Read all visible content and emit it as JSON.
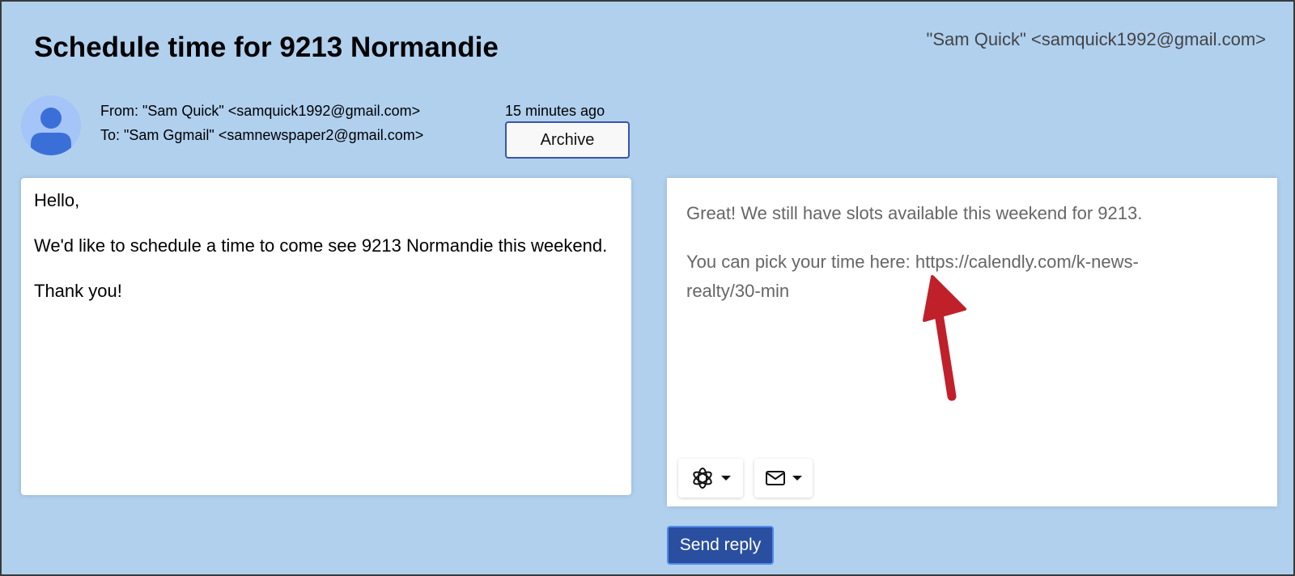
{
  "email": {
    "subject": "Schedule time for 9213 Normandie",
    "account": "\"Sam Quick\" <samquick1992@gmail.com>",
    "from_line": "From: \"Sam Quick\" <samquick1992@gmail.com>",
    "to_line": "To: \"Sam Ggmail\" <samnewspaper2@gmail.com>",
    "time": "15 minutes ago",
    "archive_label": "Archive",
    "body": {
      "line1": "Hello,",
      "line2": "We'd like to schedule a time to come see 9213 Normandie this weekend.",
      "line3": "Thank you!"
    }
  },
  "reply": {
    "line1": "Great! We still have slots available this weekend for 9213.",
    "line2": "You can pick your time here: https://calendly.com/k-news-realty/30-min",
    "ai_icon": "openai-icon",
    "mail_icon": "envelope-icon",
    "send_label": "Send reply"
  },
  "colors": {
    "background": "#b0d0ee",
    "send_button": "#2a4fa0",
    "archive_border": "#3a56a8",
    "annotation_arrow": "#c0202a"
  }
}
